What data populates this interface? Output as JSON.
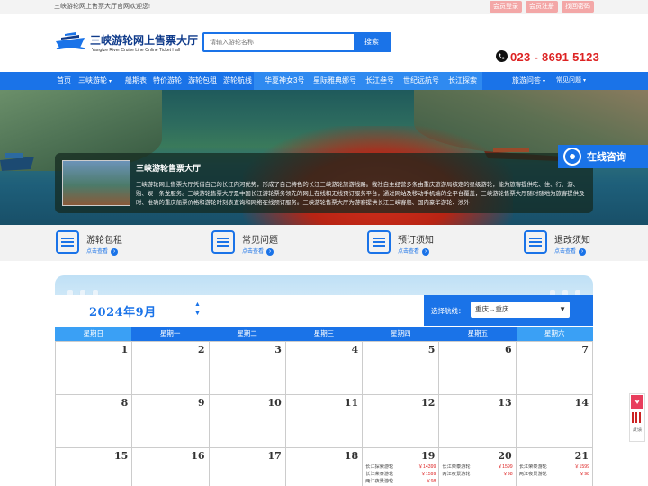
{
  "topbar": {
    "welcome": "三峡游轮网上售票大厅官网欢迎您!",
    "login": "会员登录",
    "register": "会员注册",
    "forgot": "找回密码"
  },
  "header": {
    "logo_cn": "三峡游轮网上售票大厅",
    "logo_en": "Yangtze River Cruise Line Online Ticket Hall",
    "search_placeholder": "请输入游轮名称",
    "search_button": "搜索",
    "phone": "023 - 8691 5123"
  },
  "nav": {
    "items": [
      "首页",
      "三峡游轮",
      "船期表",
      "特价游轮",
      "游轮包租",
      "游轮航线",
      "华夏神女3号",
      "星际雅典娜号",
      "长江叁号",
      "世纪远航号",
      "长江探索",
      "旅游问答",
      "常见问题"
    ]
  },
  "banner": {
    "title": "三峡游轮售票大厅",
    "text": "三峡游轮网上售票大厅凭借自己的长江内河优势，形成了自己特色的长江三峡游轮旅游线路。我社自主经营多条由重庆旅游局核定的星级游轮，能为旅客提供吃、住、行、游、购、娱一条龙服务。三峡游轮售票大厅是中国长江游轮票务领先的网上在线和无线预订服务平台，通过网站及移动手机端的全平台覆盖，三峡游轮售票大厅随时随地为旅客提供及时、准确的重庆船票价格和游轮时刻表查询和网络在线预订服务。三峡游轮售票大厅为游客提供长江三峡客船、国内豪华游轮、涉外",
    "consult": "在线咨询"
  },
  "shortcuts": [
    {
      "title": "游轮包租",
      "sub": "点击查看"
    },
    {
      "title": "常见问题",
      "sub": "点击查看"
    },
    {
      "title": "预订须知",
      "sub": "点击查看"
    },
    {
      "title": "退改须知",
      "sub": "点击查看"
    }
  ],
  "calendar": {
    "month": "2024年9月",
    "route_label": "选择航线：",
    "route_value": "重庆→重庆",
    "weekdays": [
      "星期日",
      "星期一",
      "星期二",
      "星期三",
      "星期四",
      "星期五",
      "星期六"
    ],
    "days": [
      {
        "d": "1",
        "trips": []
      },
      {
        "d": "2",
        "trips": []
      },
      {
        "d": "3",
        "trips": []
      },
      {
        "d": "4",
        "trips": []
      },
      {
        "d": "5",
        "trips": []
      },
      {
        "d": "6",
        "trips": []
      },
      {
        "d": "7",
        "trips": []
      },
      {
        "d": "8",
        "trips": []
      },
      {
        "d": "9",
        "trips": []
      },
      {
        "d": "10",
        "trips": []
      },
      {
        "d": "11",
        "trips": []
      },
      {
        "d": "12",
        "trips": []
      },
      {
        "d": "13",
        "trips": []
      },
      {
        "d": "14",
        "trips": []
      },
      {
        "d": "15",
        "trips": []
      },
      {
        "d": "16",
        "trips": []
      },
      {
        "d": "17",
        "trips": []
      },
      {
        "d": "18",
        "trips": []
      },
      {
        "d": "19",
        "trips": [
          {
            "n": "长江探索游轮",
            "p": "￥14399"
          },
          {
            "n": "长江荣泰游轮",
            "p": "￥1599"
          },
          {
            "n": "两江夜景游轮",
            "p": "￥98"
          }
        ]
      },
      {
        "d": "20",
        "trips": [
          {
            "n": "长江荣泰游轮",
            "p": "￥1599"
          },
          {
            "n": "两江夜景游轮",
            "p": "￥98"
          }
        ]
      },
      {
        "d": "21",
        "trips": [
          {
            "n": "长江荣泰游轮",
            "p": "￥1599"
          },
          {
            "n": "两江夜景游轮",
            "p": "￥98"
          }
        ]
      }
    ]
  },
  "side": {
    "feedback": "反馈"
  }
}
